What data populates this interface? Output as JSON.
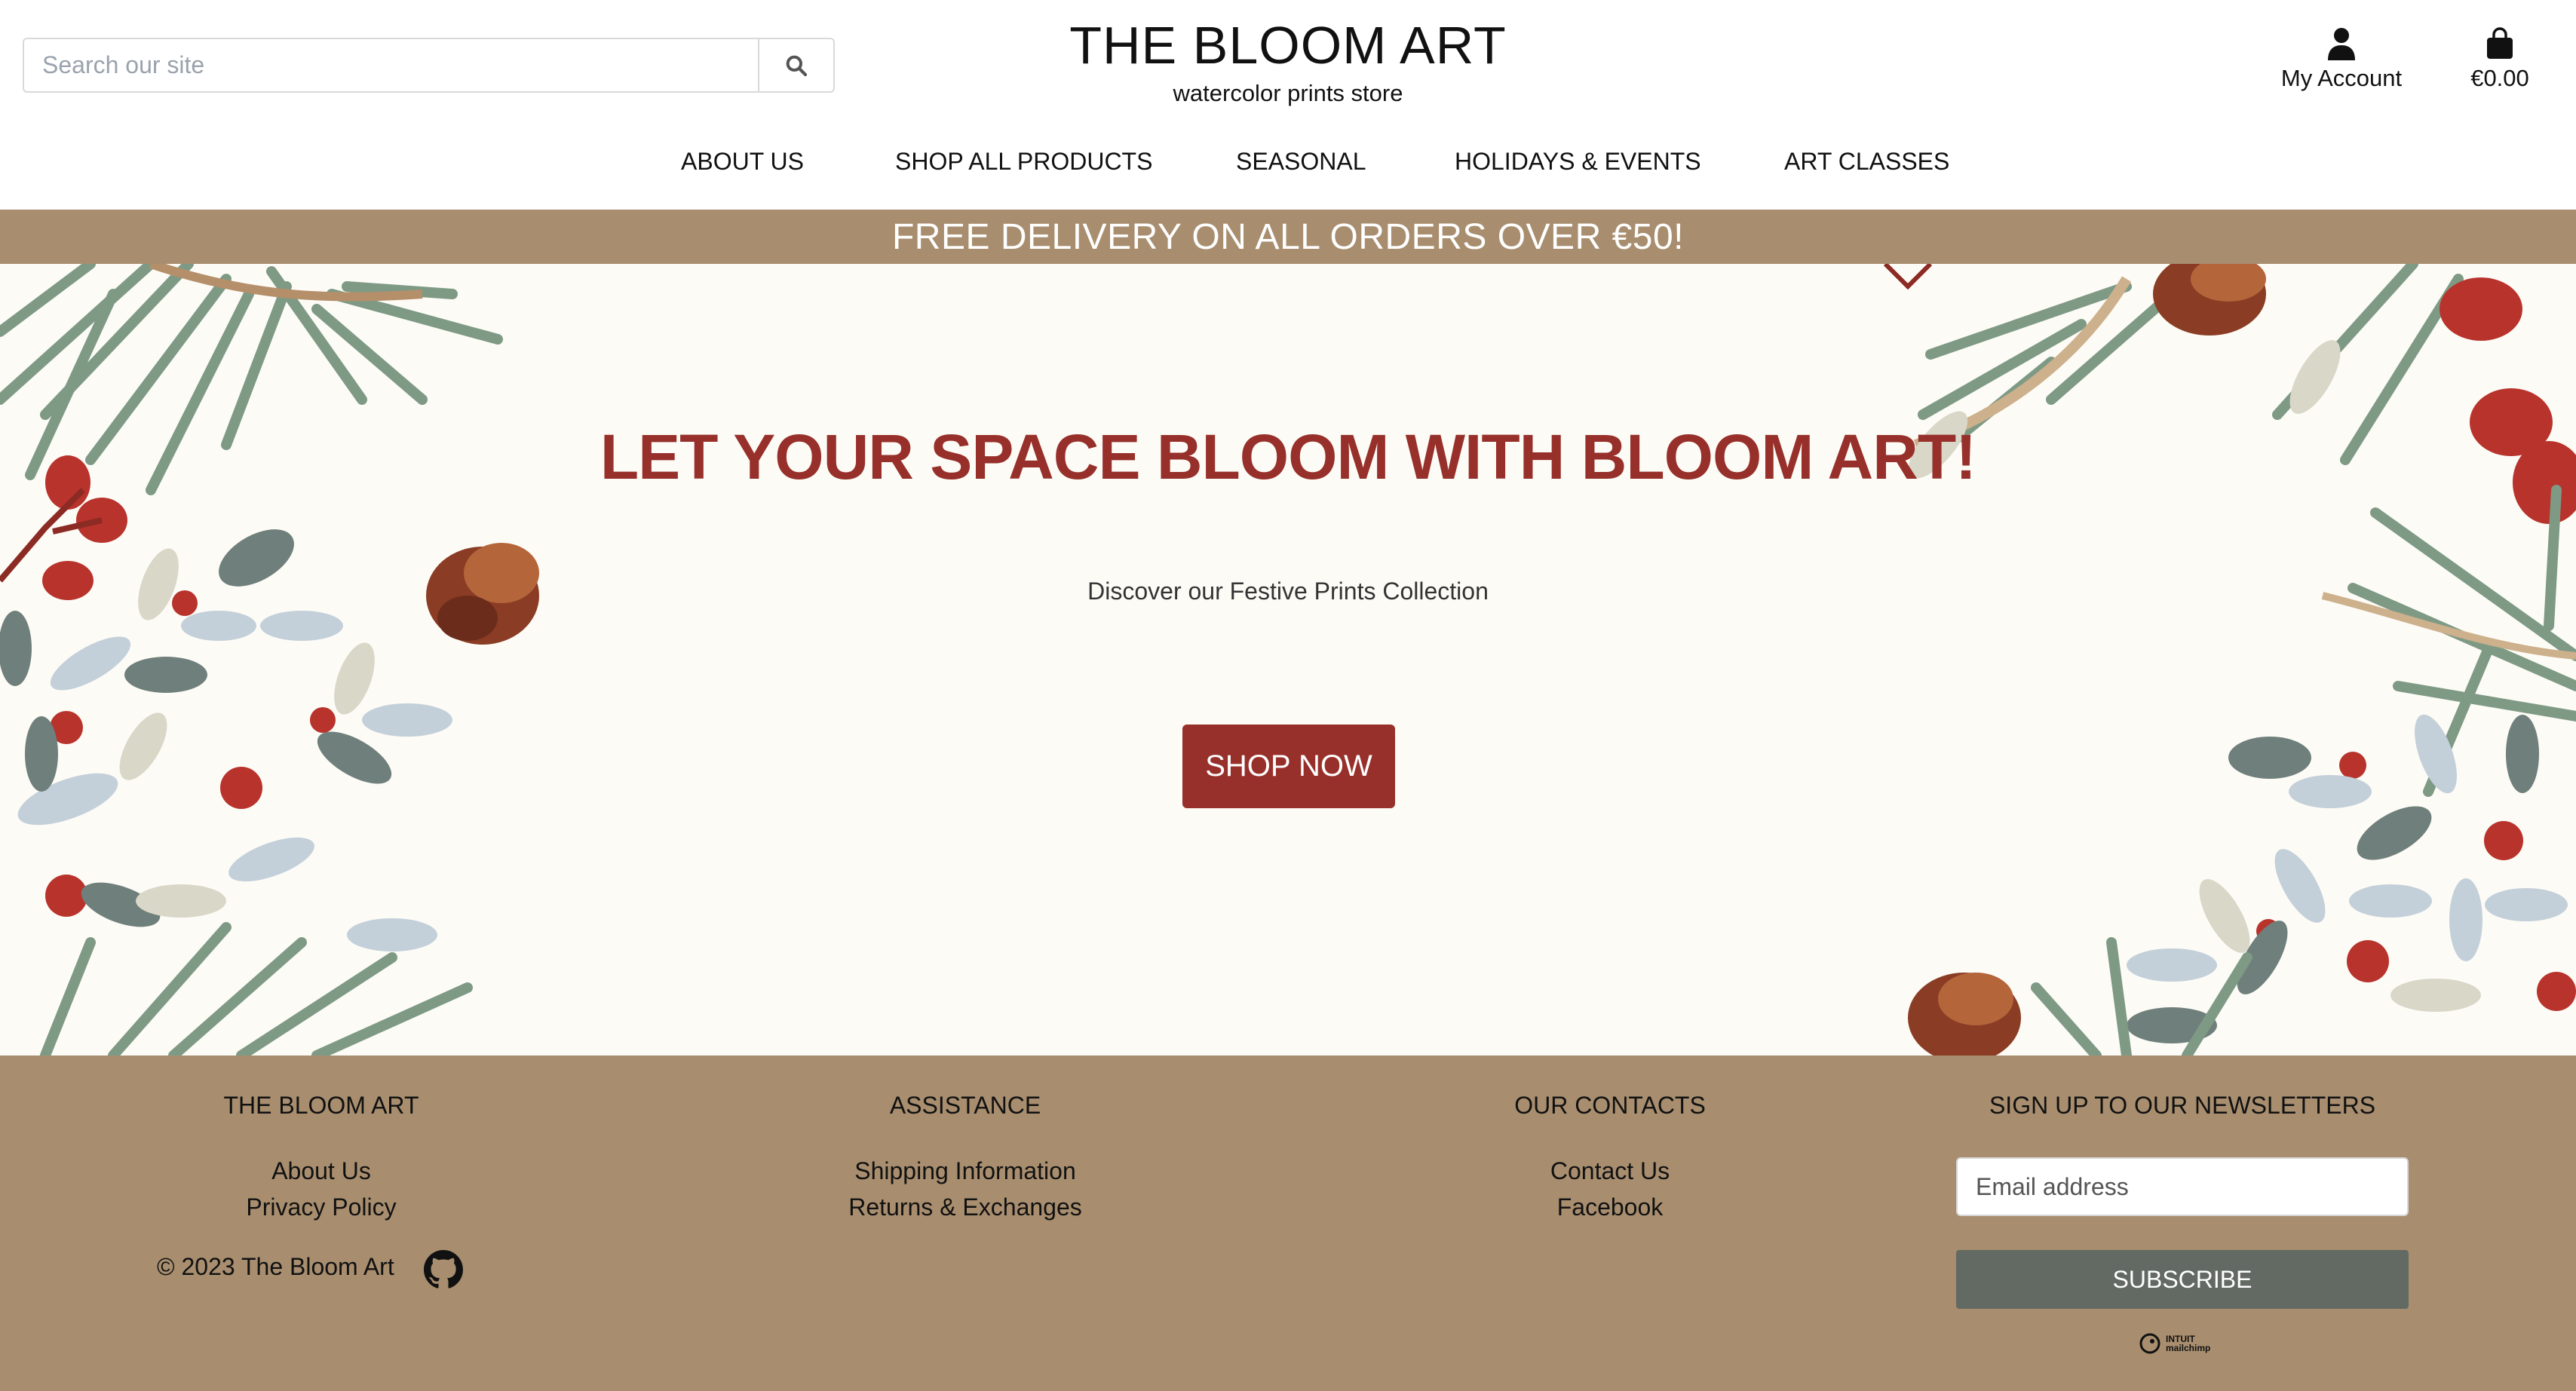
{
  "search": {
    "placeholder": "Search our site"
  },
  "brand": {
    "title": "THE BLOOM ART",
    "tagline": "watercolor prints store"
  },
  "account": {
    "label": "My Account",
    "icon": "user-icon"
  },
  "bag": {
    "total": "€0.00",
    "icon": "shopping-bag-icon"
  },
  "nav": {
    "items": [
      {
        "label": "ABOUT US"
      },
      {
        "label": "SHOP ALL PRODUCTS"
      },
      {
        "label": "SEASONAL"
      },
      {
        "label": "HOLIDAYS & EVENTS"
      },
      {
        "label": "ART CLASSES"
      }
    ]
  },
  "promo": {
    "text": "FREE DELIVERY ON ALL ORDERS OVER €50!"
  },
  "hero": {
    "title": "LET YOUR SPACE BLOOM WITH BLOOM ART!",
    "subtitle": "Discover our Festive Prints Collection",
    "cta": "SHOP NOW"
  },
  "footer": {
    "brand": {
      "heading": "THE BLOOM ART",
      "links": [
        "About Us",
        "Privacy Policy"
      ],
      "copyright": "© 2023 The Bloom Art"
    },
    "assistance": {
      "heading": "ASSISTANCE",
      "links": [
        "Shipping Information",
        "Returns & Exchanges"
      ]
    },
    "contacts": {
      "heading": "OUR CONTACTS",
      "links": [
        "Contact Us",
        "Facebook"
      ]
    },
    "newsletter": {
      "heading": "SIGN UP TO OUR NEWSLETTERS",
      "email_placeholder": "Email address",
      "subscribe": "SUBSCRIBE",
      "provider_line1": "INTUIT",
      "provider_line2": "mailchimp"
    }
  },
  "colors": {
    "accent_red": "#97302a",
    "banner_tan": "#a88e6f",
    "subscribe_gray": "#626a63",
    "hero_bg": "#fdfbf6"
  }
}
